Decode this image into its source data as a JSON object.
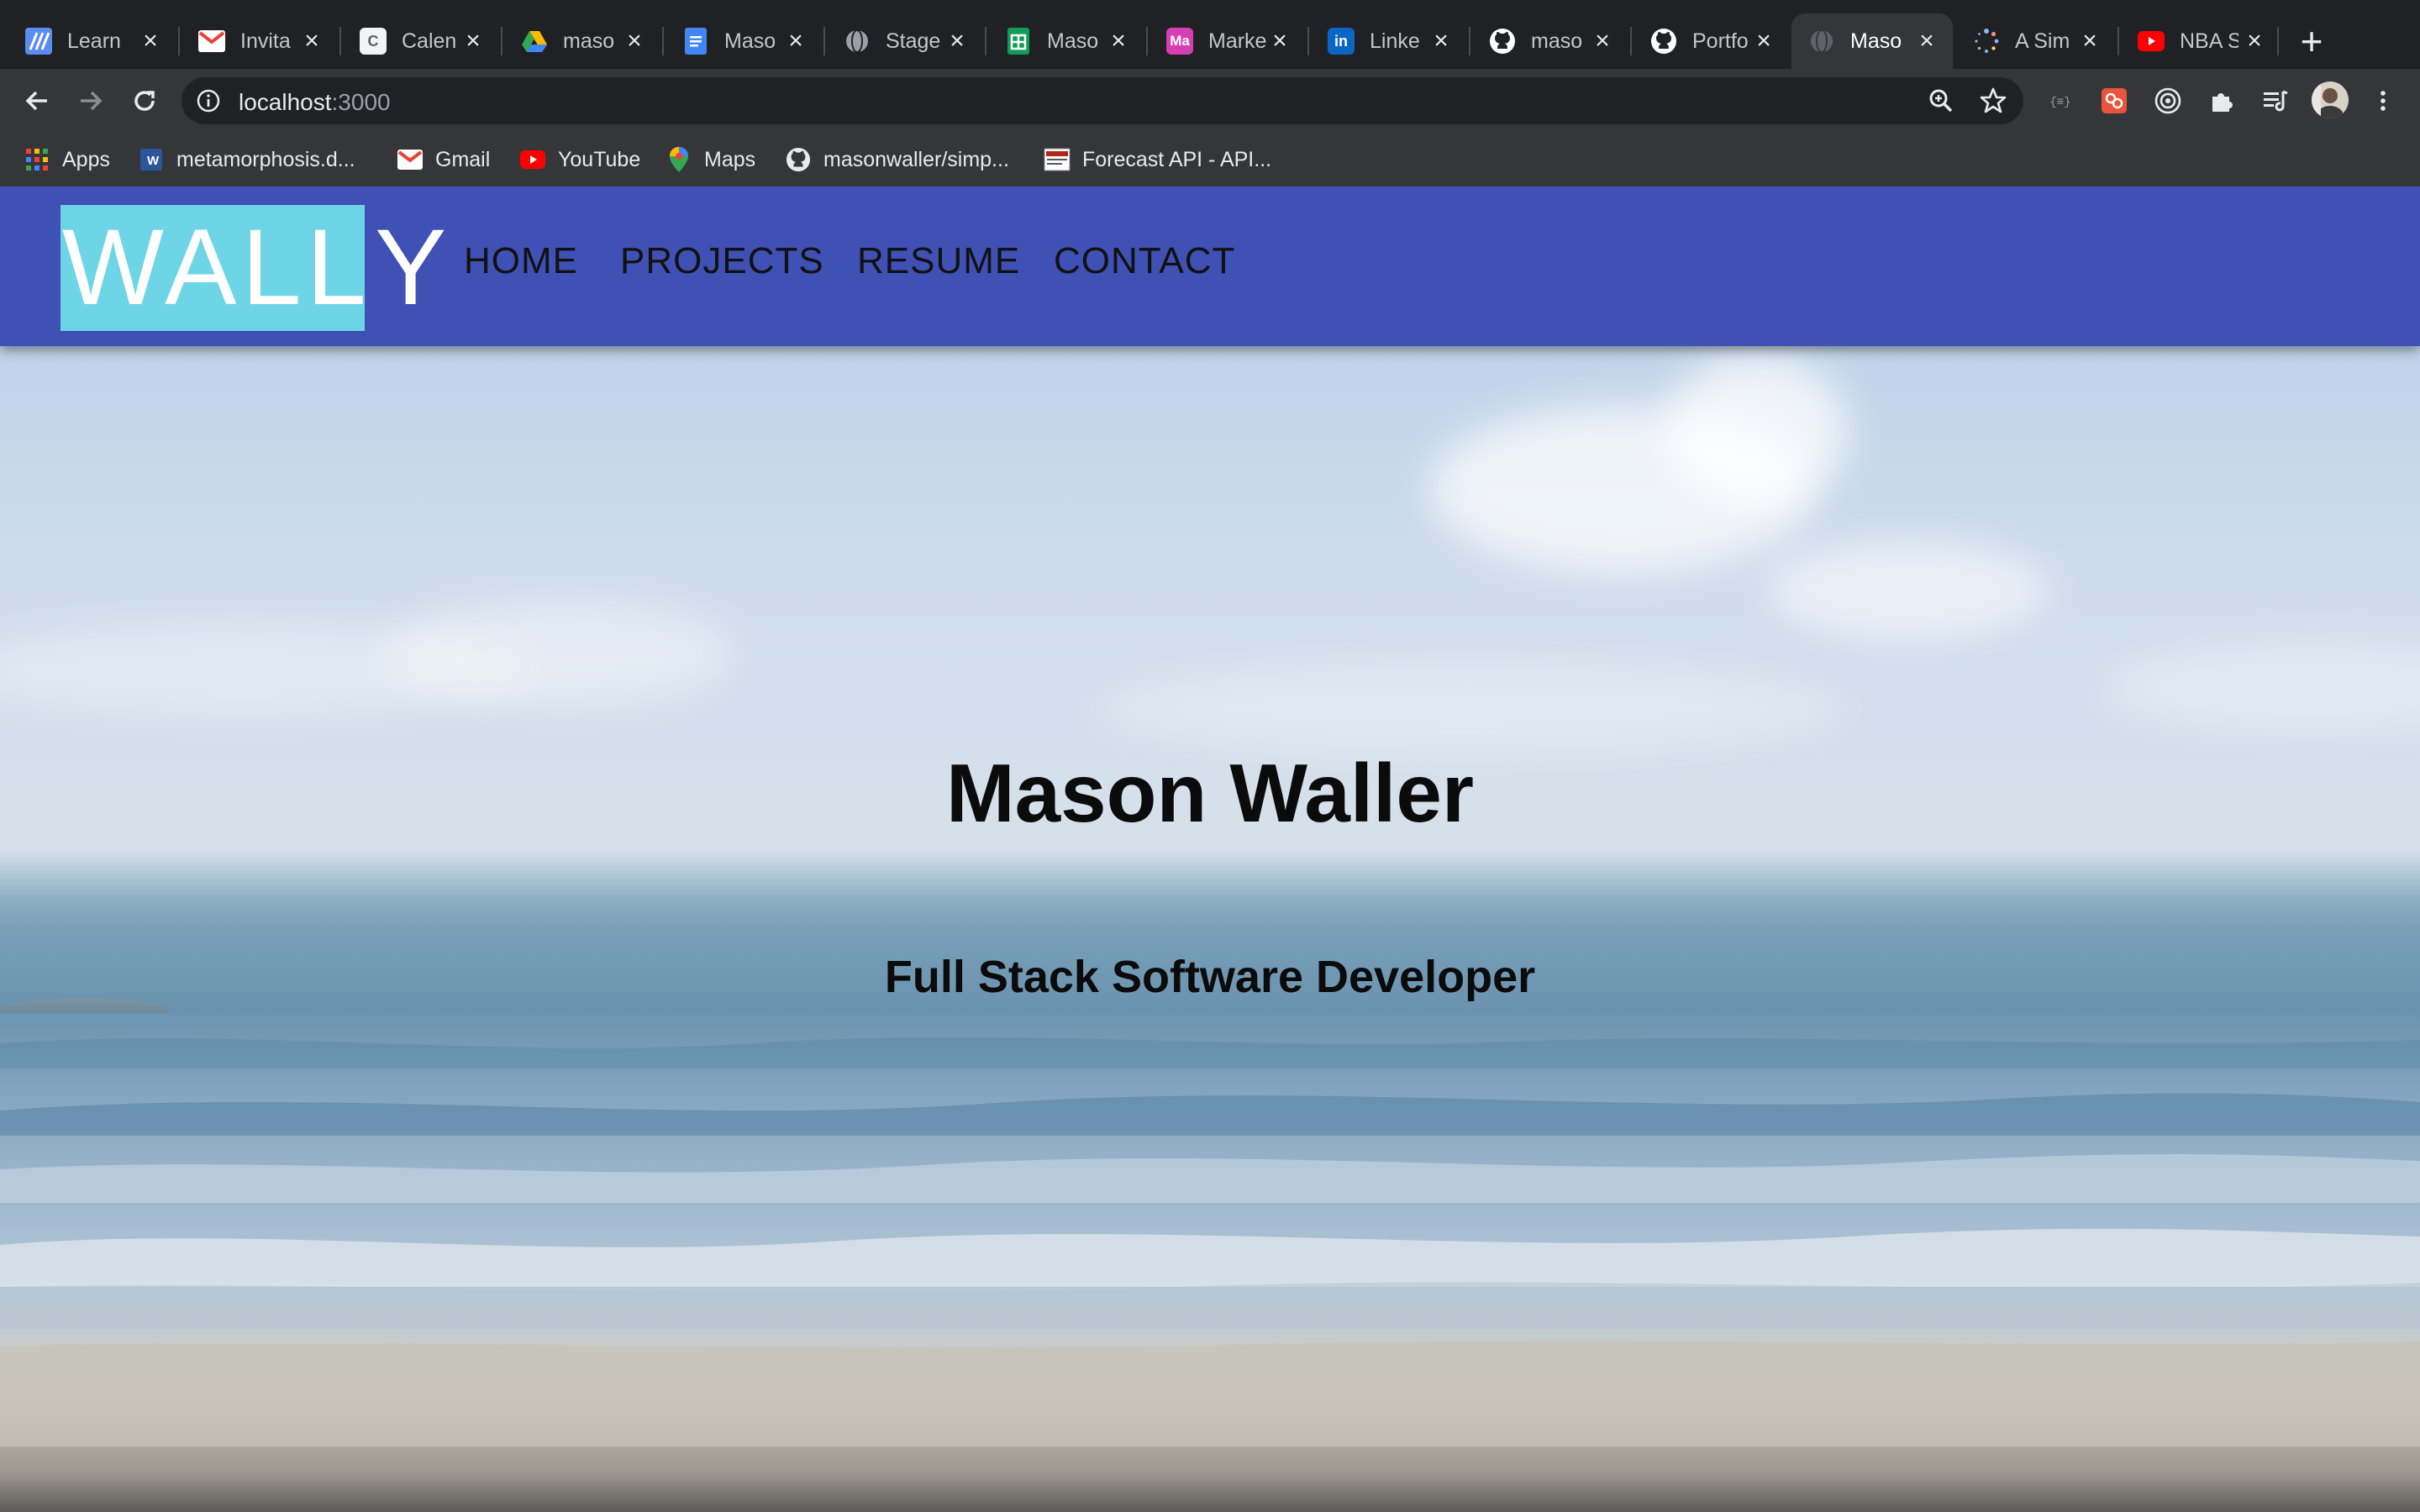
{
  "browser": {
    "tabs": [
      {
        "label": "Learn",
        "icon": "learn-icon",
        "color": "#5b8def"
      },
      {
        "label": "Invita",
        "icon": "gmail-icon",
        "color": "#ea4335"
      },
      {
        "label": "Calen",
        "icon": "calendar-icon",
        "color": "#ffffff"
      },
      {
        "label": "maso",
        "icon": "google-drive-icon",
        "color": "#34a853"
      },
      {
        "label": "Maso",
        "icon": "google-docs-icon",
        "color": "#4285f4"
      },
      {
        "label": "Stage",
        "icon": "globe-icon",
        "color": "#9aa0a6"
      },
      {
        "label": "Maso",
        "icon": "google-sheets-icon",
        "color": "#0f9d58"
      },
      {
        "label": "Marke",
        "icon": "ma-icon",
        "color": "#d63fb3"
      },
      {
        "label": "Linke",
        "icon": "linkedin-icon",
        "color": "#0a66c2"
      },
      {
        "label": "maso",
        "icon": "github-icon",
        "color": "#ffffff"
      },
      {
        "label": "Portfo",
        "icon": "github-icon",
        "color": "#ffffff"
      },
      {
        "label": "Maso",
        "icon": "globe-icon",
        "color": "#5f6368",
        "active": true
      },
      {
        "label": "A Sim",
        "icon": "spinner-icon",
        "color": "#8ab4f8"
      },
      {
        "label": "NBA S",
        "icon": "youtube-icon",
        "color": "#ff0000"
      }
    ],
    "address": {
      "host": "localhost",
      "port": ":3000"
    },
    "bookmarks": [
      {
        "label": "Apps",
        "icon": "apps-grid-icon"
      },
      {
        "label": "metamorphosis.d...",
        "icon": "word-doc-icon"
      },
      {
        "label": "Gmail",
        "icon": "gmail-icon"
      },
      {
        "label": "YouTube",
        "icon": "youtube-icon"
      },
      {
        "label": "Maps",
        "icon": "maps-pin-icon"
      },
      {
        "label": "masonwaller/simp...",
        "icon": "github-icon"
      },
      {
        "label": "Forecast API - API...",
        "icon": "forecast-icon"
      }
    ]
  },
  "site": {
    "logo": {
      "boxed": "WALL",
      "tail": "Y"
    },
    "nav": [
      "HOME",
      "PROJECTS",
      "RESUME",
      "CONTACT"
    ],
    "hero": {
      "title": "Mason Waller",
      "subtitle": "Full Stack Software Developer"
    },
    "colors": {
      "navbar": "#3f51b5",
      "logo_box": "#6ed5e6",
      "nav_text": "#111111"
    }
  }
}
